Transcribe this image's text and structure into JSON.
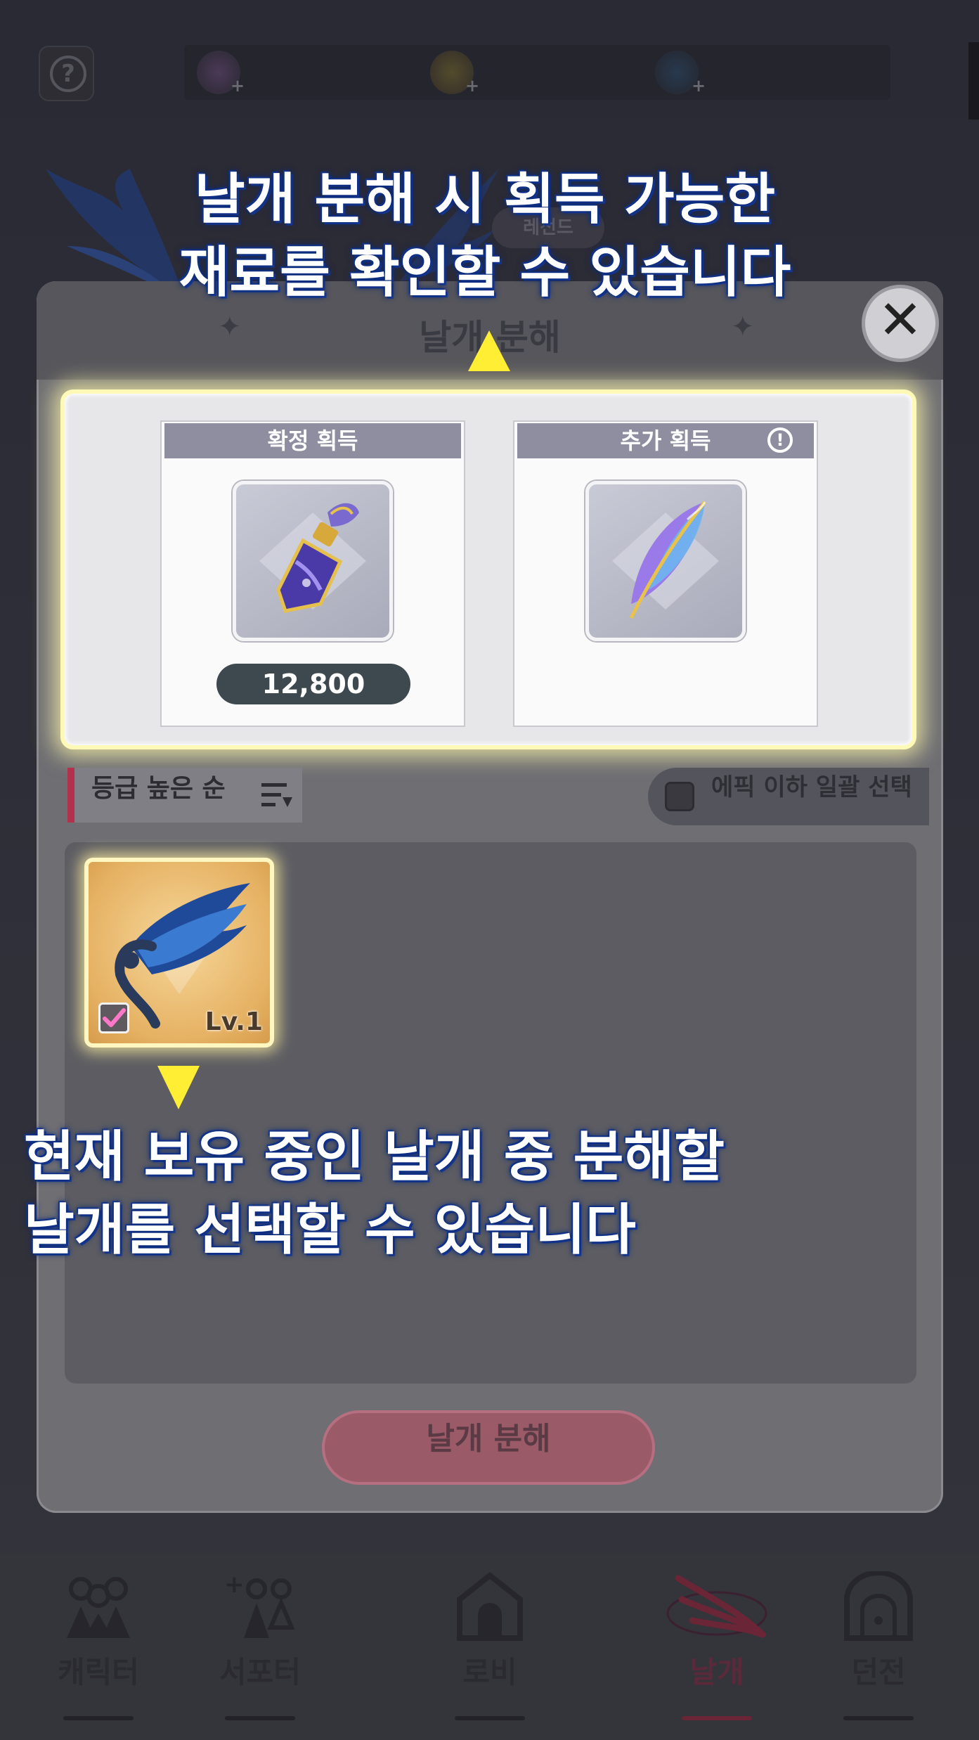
{
  "background": {
    "top_bar": {
      "help_icon": "question-mark-icon",
      "resources": [
        {
          "icon": "gem-icon",
          "plus": "+"
        },
        {
          "icon": "gold-coin-icon",
          "plus": "+"
        },
        {
          "icon": "blue-crystal-icon",
          "plus": "+"
        }
      ]
    },
    "legend_badge": "레전드"
  },
  "dialog": {
    "title": "날개 분해",
    "close_icon": "✕",
    "guaranteed_header": "확정 획득",
    "guaranteed_item_icon": "potion-bottle-icon",
    "guaranteed_quantity": "12,800",
    "extra_header": "추가 획득",
    "extra_info_icon": "!",
    "extra_item_icon": "feather-icon",
    "sort_label": "등급 높은 순",
    "bulk_select_label": "에픽 이하 일괄 선택",
    "wing_item": {
      "level": "Lv.1",
      "checked": true
    },
    "disassemble_button": "날개 분해"
  },
  "tutorial": {
    "top_line1": "날개 분해 시 획득 가능한",
    "top_line2": "재료를 확인할 수 있습니다",
    "bottom_line1": "현재 보유 중인 날개 중 분해할",
    "bottom_line2": "날개를 선택할 수 있습니다"
  },
  "bottom_nav": [
    {
      "label": "캐릭터",
      "icon": "characters-icon",
      "active": false
    },
    {
      "label": "서포터",
      "icon": "supporter-icon",
      "active": false
    },
    {
      "label": "로비",
      "icon": "lobby-house-icon",
      "active": false
    },
    {
      "label": "날개",
      "icon": "wing-icon",
      "active": true
    },
    {
      "label": "던전",
      "icon": "dungeon-gate-icon",
      "active": false
    }
  ],
  "colors": {
    "highlight": "#fff9b8",
    "tutorial_arrow": "#ffee33",
    "active_nav": "#6a2536",
    "sort_accent": "#b2314d"
  }
}
